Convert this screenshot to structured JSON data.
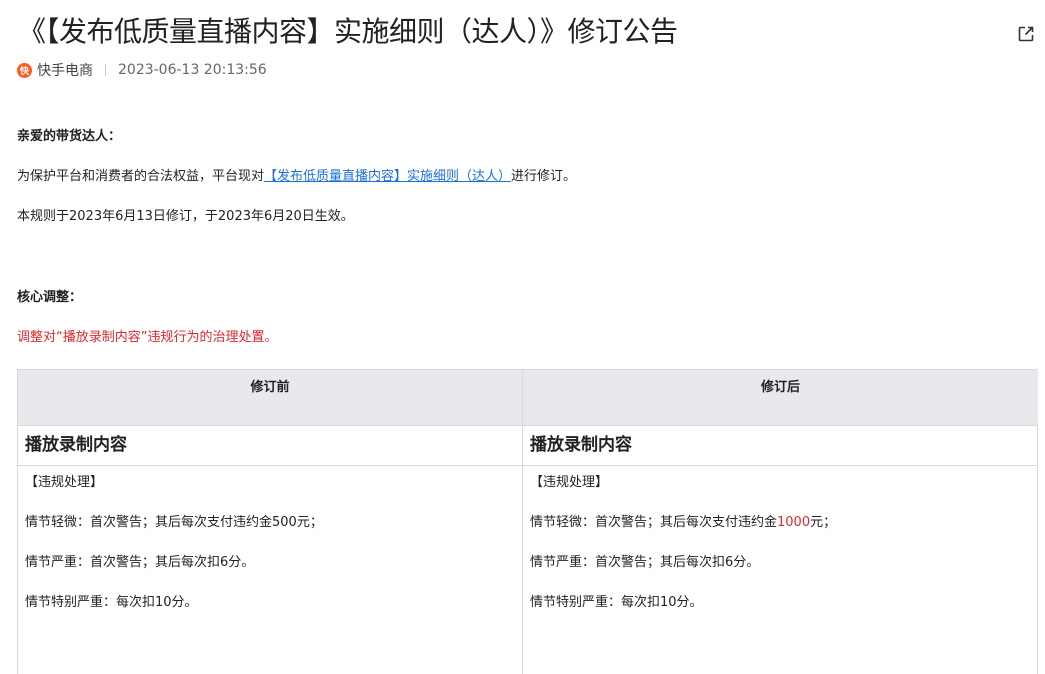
{
  "header": {
    "title": "《【发布低质量直播内容】实施细则（达人）》修订公告",
    "source_name": "快手电商",
    "source_logo_text": "快",
    "date": "2023-06-13 20:13:56"
  },
  "body": {
    "greeting": "亲爱的带货达人：",
    "intro_prefix": "为保护平台和消费者的合法权益，平台现对",
    "intro_link": "【发布低质量直播内容】实施细则（达人）",
    "intro_suffix": "进行修订。",
    "effective": "本规则于2023年6月13日修订，于2023年6月20日生效。",
    "core_heading": "核心调整：",
    "core_note": "调整对“播放录制内容”违规行为的治理处置。"
  },
  "table": {
    "headers": [
      "修订前",
      "修订后"
    ],
    "before": {
      "subheading": "播放录制内容",
      "handling": "【违规处理】",
      "minor": "情节轻微：首次警告；其后每次支付违约金500元；",
      "serious": "情节严重：首次警告；其后每次扣6分。",
      "very_serious": "情节特别严重：每次扣10分。"
    },
    "after": {
      "subheading": "播放录制内容",
      "handling": "【违规处理】",
      "minor_prefix": "情节轻微：首次警告；其后每次支付违约金",
      "minor_amount": "1000",
      "minor_suffix": "元；",
      "serious": "情节严重：首次警告；其后每次扣6分。",
      "very_serious": "情节特别严重：每次扣10分。"
    }
  },
  "icons": {
    "external": "external-link-icon"
  },
  "colors": {
    "accent_red": "#e0282e",
    "link_blue": "#1e6fd9",
    "brand_orange": "#ff5a1f"
  }
}
